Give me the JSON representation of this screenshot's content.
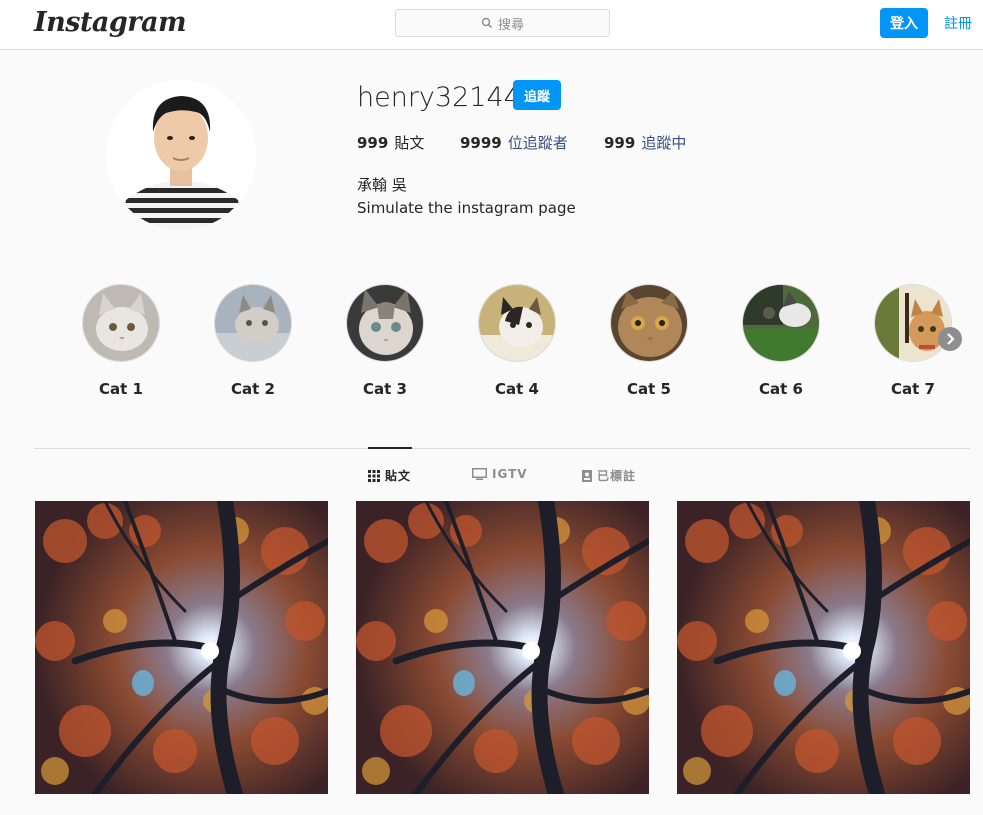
{
  "header": {
    "logo": "Instagram",
    "search_placeholder": "搜尋",
    "login_label": "登入",
    "signup_label": "註冊"
  },
  "profile": {
    "username": "henry32144",
    "follow_label": "追蹤",
    "posts_count": "999",
    "posts_label": "貼文",
    "followers_count": "9999",
    "followers_label": "位追蹤者",
    "following_count": "999",
    "following_label": "追蹤中",
    "full_name": "承翰 吳",
    "bio": "Simulate the instagram page"
  },
  "highlights": [
    {
      "label": "Cat 1"
    },
    {
      "label": "Cat 2"
    },
    {
      "label": "Cat 3"
    },
    {
      "label": "Cat 4"
    },
    {
      "label": "Cat 5"
    },
    {
      "label": "Cat 6"
    },
    {
      "label": "Cat 7"
    }
  ],
  "tabs": [
    {
      "label": "貼文",
      "icon": "grid-icon",
      "active": true
    },
    {
      "label": "IGTV",
      "icon": "tv-icon",
      "active": false
    },
    {
      "label": "已標註",
      "icon": "tag-icon",
      "active": false
    }
  ],
  "colors": {
    "accent": "#0095f6",
    "border": "#dbdbdb",
    "background": "#fafafa"
  }
}
